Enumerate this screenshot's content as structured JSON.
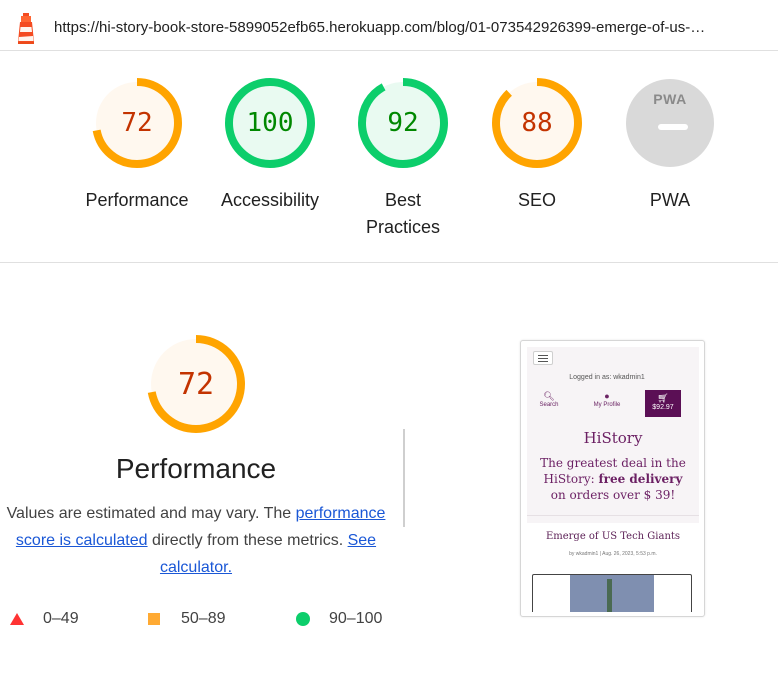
{
  "url": "https://hi-story-book-store-5899052efb65.herokuapp.com/blog/01-073542926399-emerge-of-us-…",
  "gauges": [
    {
      "score": "72",
      "label": "Performance",
      "fraction": 0.72,
      "color": "#ffa400",
      "text_color": "#c33300",
      "fill": "#fff8ef"
    },
    {
      "score": "100",
      "label": "Accessibility",
      "fraction": 1.0,
      "color": "#0cce6b",
      "text_color": "#008800",
      "fill": "#e9faf1"
    },
    {
      "score": "92",
      "label": "Best Practices",
      "fraction": 0.92,
      "color": "#0cce6b",
      "text_color": "#008800",
      "fill": "#e9faf1"
    },
    {
      "score": "88",
      "label": "SEO",
      "fraction": 0.88,
      "color": "#ffa400",
      "text_color": "#c33300",
      "fill": "#fff8ef"
    },
    {
      "score": "",
      "label": "PWA",
      "badge": "PWA",
      "color": "#d9d9d9"
    }
  ],
  "detail": {
    "score": "72",
    "fraction": 0.72,
    "title": "Performance",
    "desc_prefix": "Values are estimated and may vary. The ",
    "link1": "performance score is calculated",
    "desc_middle": " directly from these metrics. ",
    "link2": "See calculator."
  },
  "legend": [
    {
      "shape": "triangle",
      "range": "0–49",
      "color": "#ff3333"
    },
    {
      "shape": "square",
      "range": "50–89",
      "color": "#ffaa33"
    },
    {
      "shape": "circle",
      "range": "90–100",
      "color": "#0cce6b"
    }
  ],
  "thumbnail": {
    "logged_in": "Logged in as: wkadmin1",
    "search": "Search",
    "profile": "My Profile",
    "cart_total": "$92.97",
    "brand": "HiStory",
    "promo_prefix": "The greatest deal in the HiStory: ",
    "promo_bold": "free delivery",
    "promo_suffix": " on orders over $ 39!",
    "post_title": "Emerge of US Tech Giants",
    "post_meta": "by wkadmin1 | Aug. 26, 2023, 5:53 p.m."
  }
}
